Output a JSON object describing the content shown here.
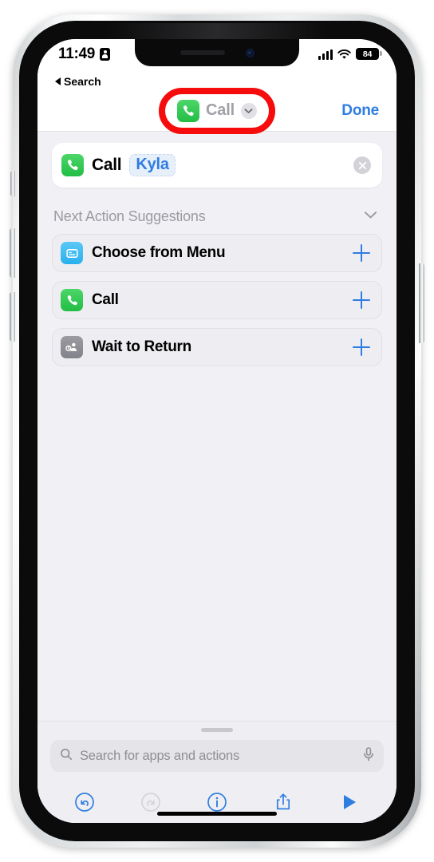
{
  "status_bar": {
    "time": "11:49",
    "location_icon": "contact-location-icon",
    "signal_icon": "cellular-bars-icon",
    "wifi_icon": "wifi-icon",
    "battery_level": "84"
  },
  "back": {
    "label": "Search",
    "icon": "triangle-left-icon"
  },
  "navbar": {
    "app_icon": "phone-icon",
    "title": "Call",
    "chevron_icon": "chevron-down-icon",
    "done_label": "Done",
    "annotation_color": "#f60c0c"
  },
  "action_card": {
    "icon": "phone-icon",
    "verb": "Call",
    "token": "Kyla",
    "close_icon": "close-circle-icon"
  },
  "suggestions": {
    "header": "Next Action Suggestions",
    "collapse_icon": "chevron-down-icon",
    "items": [
      {
        "label": "Choose from Menu",
        "icon": "menu-card-icon",
        "icon_color": "cyan",
        "add_icon": "plus-icon"
      },
      {
        "label": "Call",
        "icon": "phone-icon",
        "icon_color": "green",
        "add_icon": "plus-icon"
      },
      {
        "label": "Wait to Return",
        "icon": "person-wait-icon",
        "icon_color": "gray",
        "add_icon": "plus-icon"
      }
    ]
  },
  "search": {
    "placeholder": "Search for apps and actions",
    "search_icon": "search-icon",
    "mic_icon": "microphone-icon"
  },
  "toolbar": {
    "buttons": [
      {
        "name": "undo-button",
        "icon": "undo-icon",
        "enabled": true
      },
      {
        "name": "redo-button",
        "icon": "redo-icon",
        "enabled": false
      },
      {
        "name": "info-button",
        "icon": "info-circle-icon",
        "enabled": true
      },
      {
        "name": "share-button",
        "icon": "share-icon",
        "enabled": true
      },
      {
        "name": "run-button",
        "icon": "play-icon",
        "enabled": true
      }
    ]
  },
  "colors": {
    "accent_blue": "#2f7de1",
    "phone_green": "#2cc24a",
    "menu_cyan": "#36b4ef",
    "wait_gray": "#8c8c94",
    "screen_bg": "#f1f1f5",
    "annotation_red": "#f60c0c"
  }
}
